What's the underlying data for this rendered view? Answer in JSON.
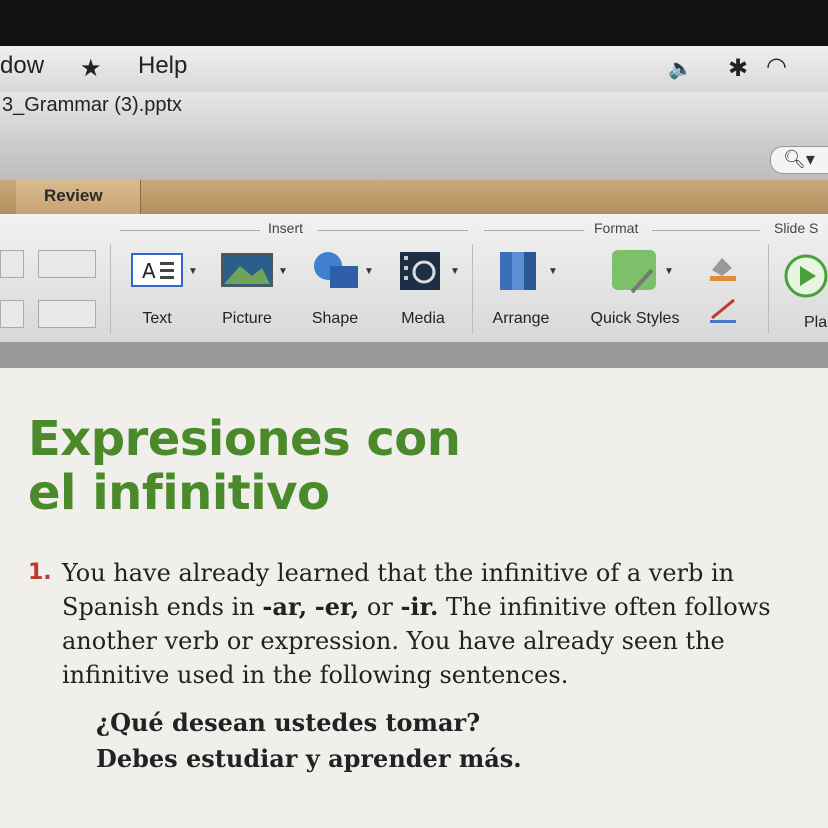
{
  "menu": {
    "window_partial": "dow",
    "help": "Help"
  },
  "document": {
    "title_partial": "3_Grammar (3).pptx"
  },
  "tabs": {
    "active": "Review"
  },
  "ribbon": {
    "groups": {
      "insert": "Insert",
      "format": "Format",
      "slide_show_partial": "Slide S"
    },
    "buttons": {
      "text": "Text",
      "picture": "Picture",
      "shape": "Shape",
      "media": "Media",
      "arrange": "Arrange",
      "quick_styles": "Quick Styles",
      "play_partial": "Pla"
    }
  },
  "slide": {
    "heading_line1": "Expresiones con",
    "heading_line2": "el infinitivo",
    "item_number": "1.",
    "para_part1": "You have already learned that the infinitive of a verb in Spanish ends in ",
    "ending_ar": "-ar,",
    "ending_er": "-er,",
    "or_word": " or ",
    "ending_ir": "-ir.",
    "para_part2": " The infinitive often follows another verb or expression. You have already seen the infinitive used in the following sentences.",
    "example1": "¿Qué desean ustedes tomar?",
    "example2": "Debes estudiar y aprender más."
  },
  "colors": {
    "heading_green": "#4a8a2a",
    "number_red": "#c0392b",
    "tab_tan": "#c9a372"
  }
}
